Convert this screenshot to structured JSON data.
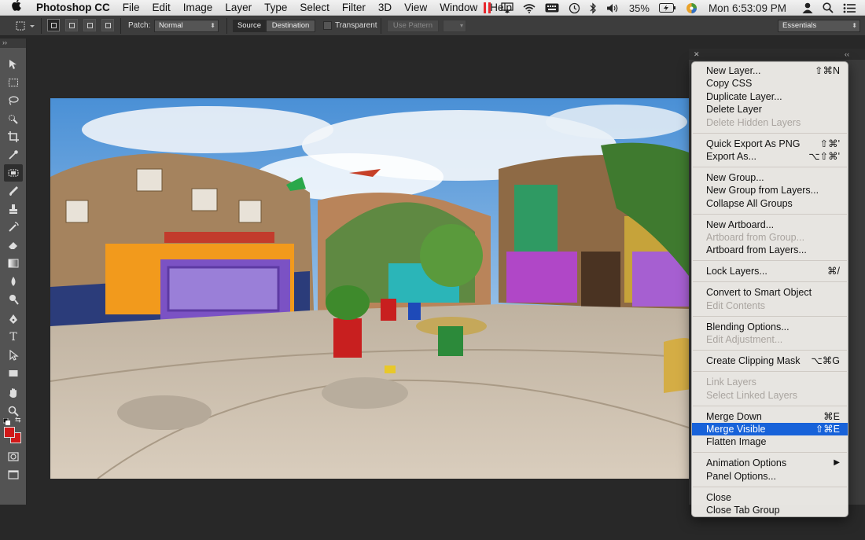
{
  "menubar": {
    "apple_icon": "apple-logo-icon",
    "app_name": "Photoshop CC",
    "menus": [
      "File",
      "Edit",
      "Image",
      "Layer",
      "Type",
      "Select",
      "Filter",
      "3D",
      "View",
      "Window",
      "Help"
    ],
    "battery": "35%",
    "clock": "Mon 6:53:09 PM"
  },
  "options_bar": {
    "patch_label": "Patch:",
    "patch_value": "Normal",
    "source_label": "Source",
    "destination_label": "Destination",
    "transparent_label": "Transparent",
    "use_pattern_label": "Use Pattern",
    "workspace_value": "Essentials"
  },
  "panel_menu": {
    "groups": [
      [
        {
          "label": "New Layer...",
          "shortcut": "⇧⌘N",
          "disabled": false
        },
        {
          "label": "Copy CSS",
          "shortcut": "",
          "disabled": false
        },
        {
          "label": "Duplicate Layer...",
          "shortcut": "",
          "disabled": false
        },
        {
          "label": "Delete Layer",
          "shortcut": "",
          "disabled": false
        },
        {
          "label": "Delete Hidden Layers",
          "shortcut": "",
          "disabled": true
        }
      ],
      [
        {
          "label": "Quick Export As PNG",
          "shortcut": "⇧⌘'",
          "disabled": false
        },
        {
          "label": "Export As...",
          "shortcut": "⌥⇧⌘'",
          "disabled": false
        }
      ],
      [
        {
          "label": "New Group...",
          "shortcut": "",
          "disabled": false
        },
        {
          "label": "New Group from Layers...",
          "shortcut": "",
          "disabled": false
        },
        {
          "label": "Collapse All Groups",
          "shortcut": "",
          "disabled": false
        }
      ],
      [
        {
          "label": "New Artboard...",
          "shortcut": "",
          "disabled": false
        },
        {
          "label": "Artboard from Group...",
          "shortcut": "",
          "disabled": true
        },
        {
          "label": "Artboard from Layers...",
          "shortcut": "",
          "disabled": false
        }
      ],
      [
        {
          "label": "Lock Layers...",
          "shortcut": "⌘/",
          "disabled": false
        }
      ],
      [
        {
          "label": "Convert to Smart Object",
          "shortcut": "",
          "disabled": false
        },
        {
          "label": "Edit Contents",
          "shortcut": "",
          "disabled": true
        }
      ],
      [
        {
          "label": "Blending Options...",
          "shortcut": "",
          "disabled": false
        },
        {
          "label": "Edit Adjustment...",
          "shortcut": "",
          "disabled": true
        }
      ],
      [
        {
          "label": "Create Clipping Mask",
          "shortcut": "⌥⌘G",
          "disabled": false
        }
      ],
      [
        {
          "label": "Link Layers",
          "shortcut": "",
          "disabled": true
        },
        {
          "label": "Select Linked Layers",
          "shortcut": "",
          "disabled": true
        }
      ],
      [
        {
          "label": "Merge Down",
          "shortcut": "⌘E",
          "disabled": false
        },
        {
          "label": "Merge Visible",
          "shortcut": "⇧⌘E",
          "disabled": false,
          "selected": true
        },
        {
          "label": "Flatten Image",
          "shortcut": "",
          "disabled": false
        }
      ],
      [
        {
          "label": "Animation Options",
          "shortcut": "▶",
          "disabled": false
        },
        {
          "label": "Panel Options...",
          "shortcut": "",
          "disabled": false
        }
      ],
      [
        {
          "label": "Close",
          "shortcut": "",
          "disabled": false
        },
        {
          "label": "Close Tab Group",
          "shortcut": "",
          "disabled": false
        }
      ]
    ]
  },
  "colors": {
    "foreground": "#d01818",
    "background": "#d01818",
    "selection": "#1762d9"
  }
}
